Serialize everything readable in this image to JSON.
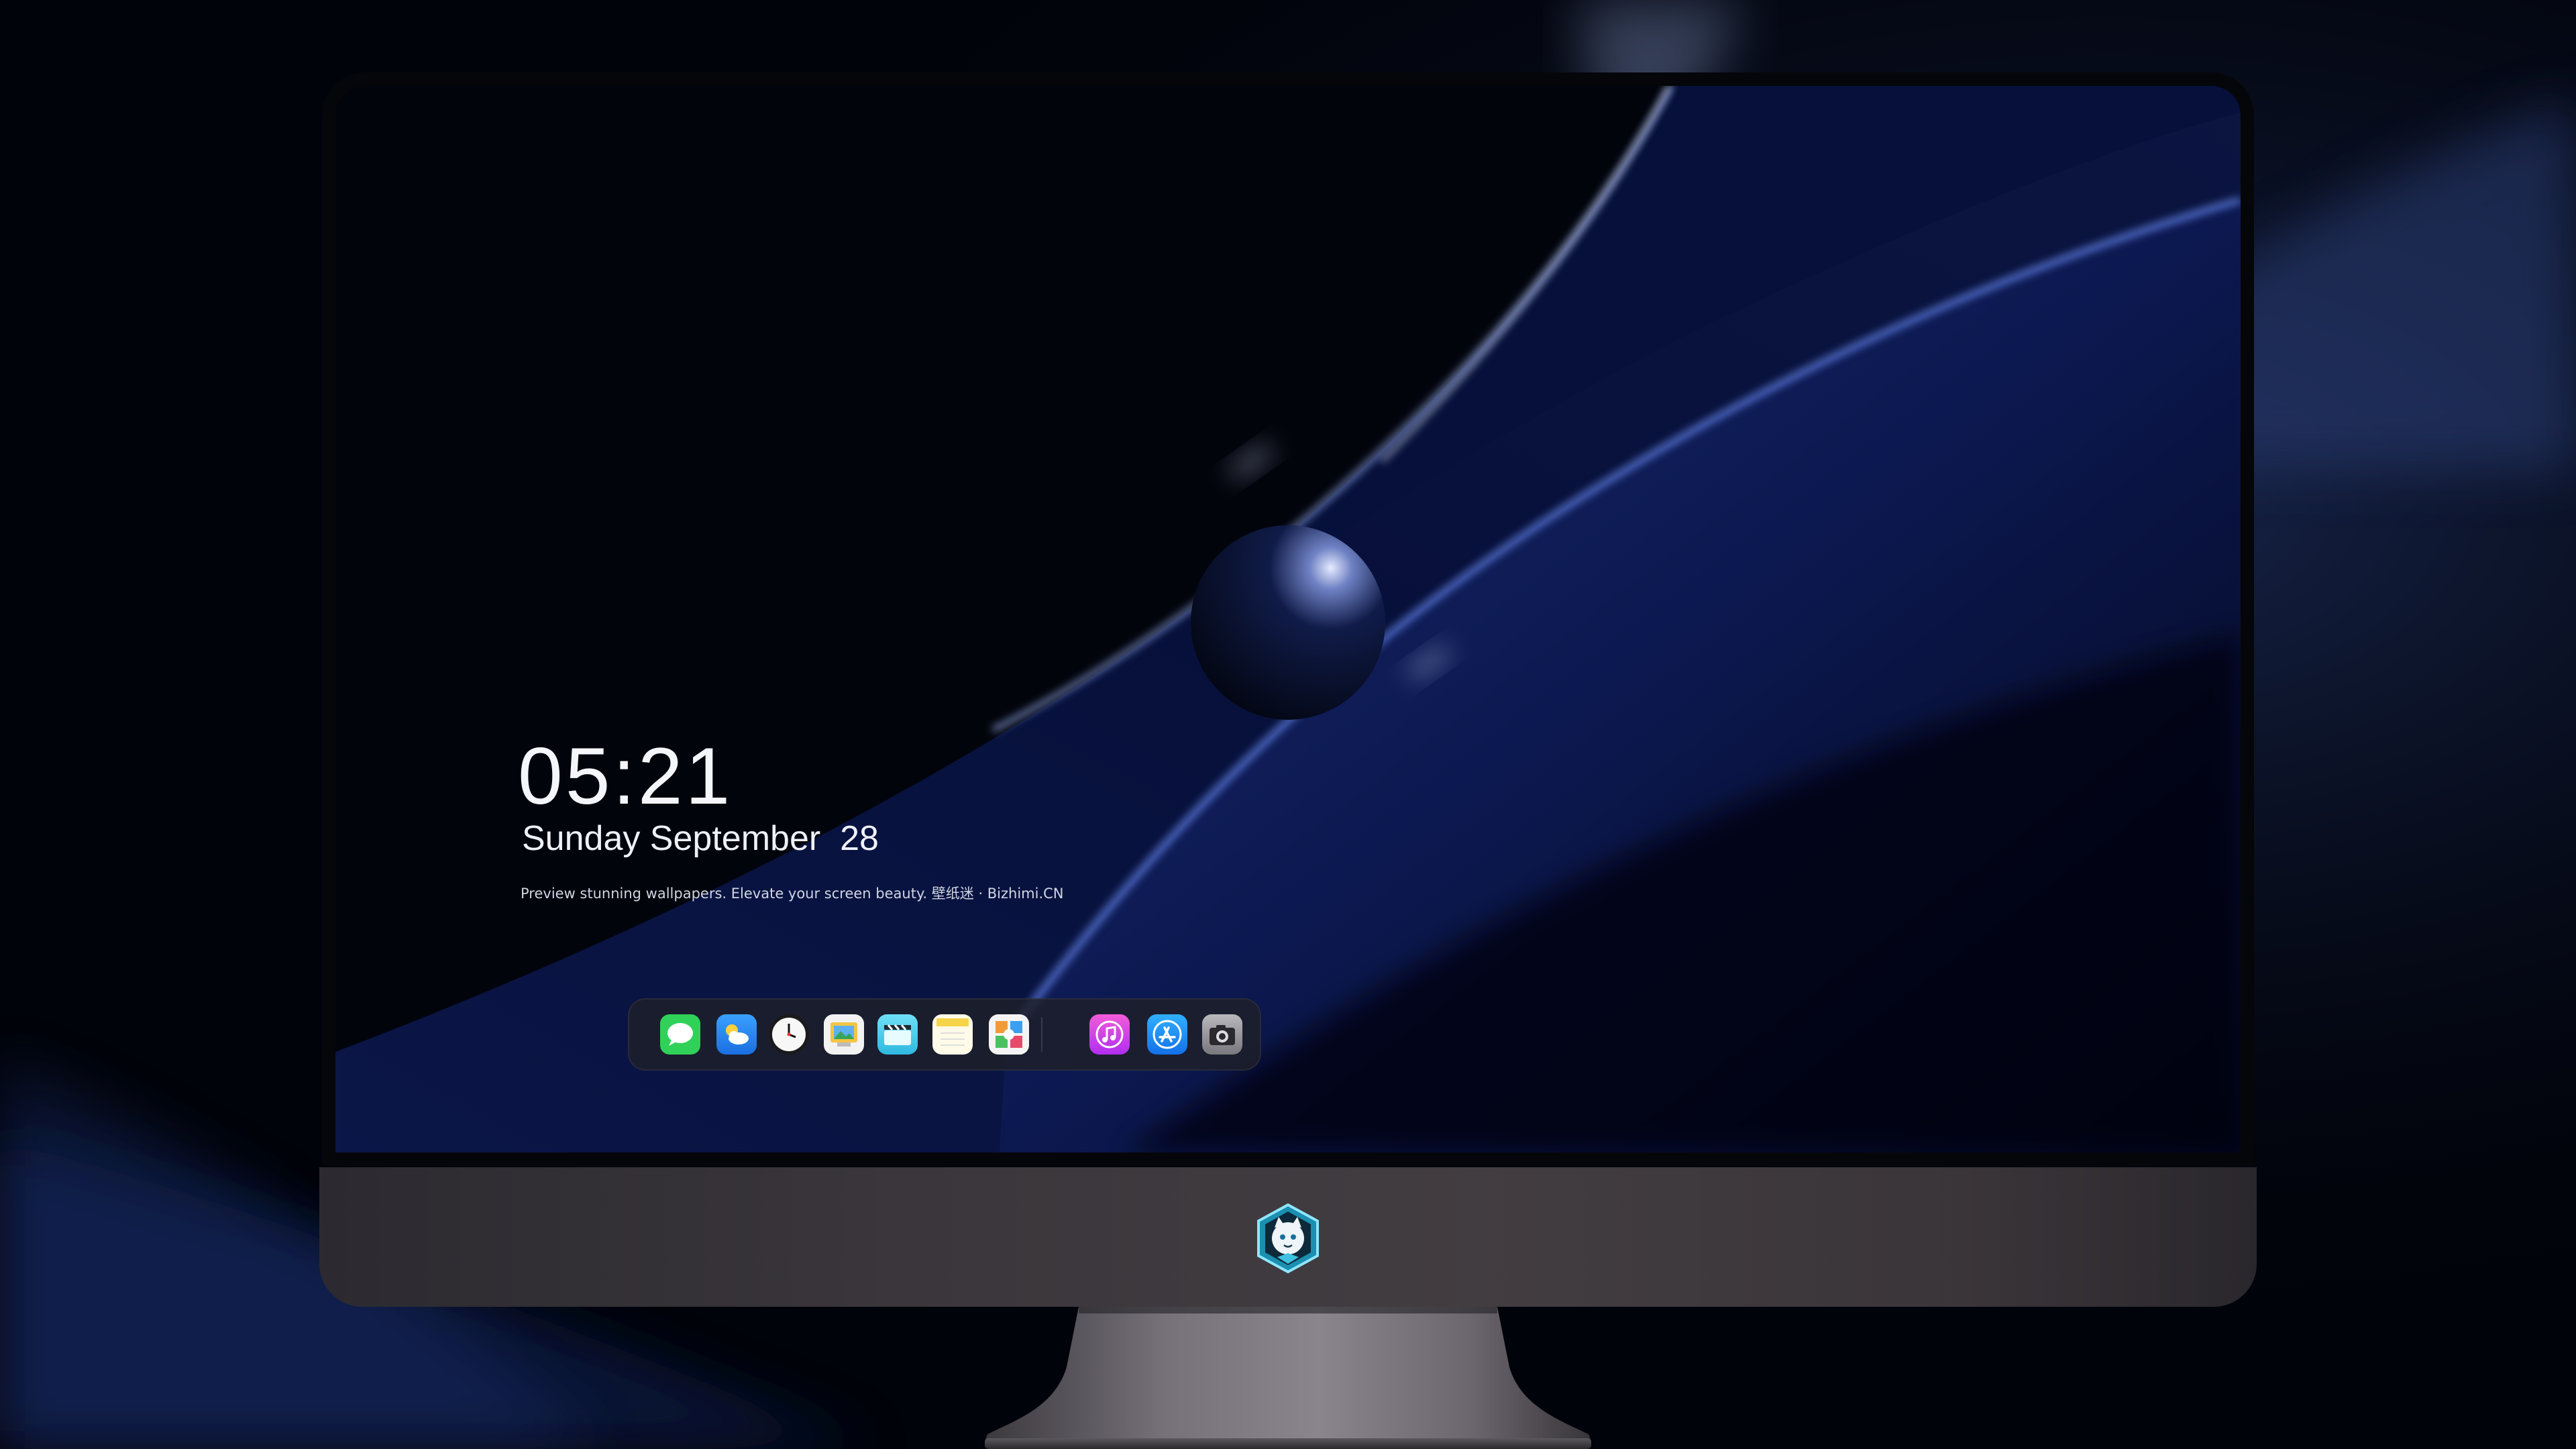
{
  "lockscreen": {
    "time": "05:21",
    "date": "Sunday September  28",
    "tagline": "Preview stunning wallpapers. Elevate your screen beauty. 壁纸迷 · Bizhimi.CN"
  },
  "dock": {
    "apps": [
      {
        "name": "messages",
        "icon": "speech-bubble-icon",
        "color": "#2fd158"
      },
      {
        "name": "weather",
        "icon": "cloud-sun-icon",
        "color": "#2a8cf0"
      },
      {
        "name": "clock",
        "icon": "clock-icon",
        "color": "#f2f2f2"
      },
      {
        "name": "preview",
        "icon": "photo-viewer-icon",
        "color": "#e9c54a"
      },
      {
        "name": "clips",
        "icon": "clapperboard-icon",
        "color": "#5ad4f0"
      },
      {
        "name": "notes",
        "icon": "notepad-icon",
        "color": "#fff3b8"
      },
      {
        "name": "photos",
        "icon": "photo-collage-icon",
        "color": "#f6f6f6"
      },
      {
        "name": "music",
        "icon": "music-note-icon",
        "color": "#d63cf0"
      },
      {
        "name": "app-store",
        "icon": "app-store-icon",
        "color": "#1c8cf7"
      },
      {
        "name": "camera",
        "icon": "camera-icon",
        "color": "#8e8e93"
      }
    ]
  },
  "branding": {
    "chin_logo": "mascot-logo-icon"
  },
  "colors": {
    "accent_blue": "#2a55c8",
    "wallpaper_dark": "#02040c",
    "chin": "#3d383c",
    "stand": "#6a666c"
  }
}
